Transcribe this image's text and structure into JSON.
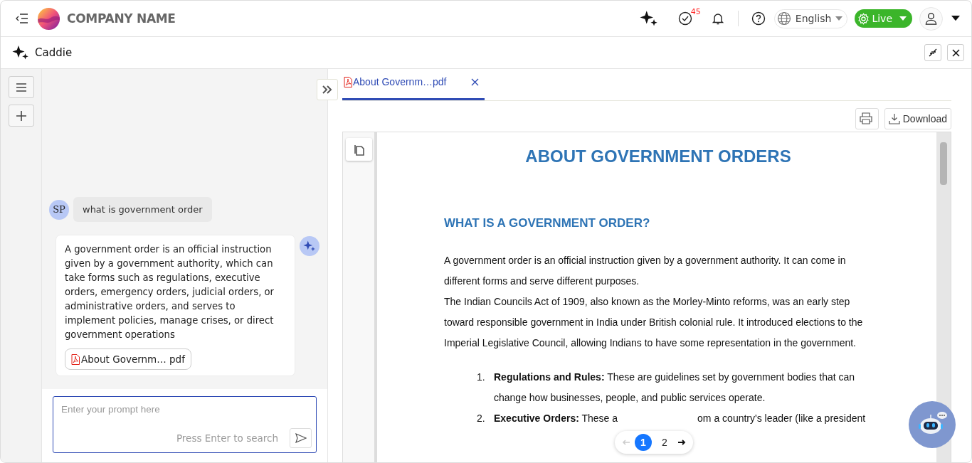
{
  "header": {
    "company_name": "COMPANY NAME",
    "notification_badge": "45",
    "language": "English",
    "status": "Live"
  },
  "panel": {
    "title": "Caddie"
  },
  "chat": {
    "messages": [
      {
        "kind": "user",
        "initials": "SP",
        "text": "what is government order"
      },
      {
        "kind": "bot",
        "text": "A government order is an official instruction given by a government authority, which can take forms such as regulations, executive orders, emergency orders, judicial orders, or administrative orders, and serves to implement policies, manage crises, or direct government operations",
        "attachment": "About Governm… pdf"
      }
    ],
    "input": {
      "placeholder": "Enter your prompt here",
      "hint": "Press Enter to search"
    }
  },
  "viewer": {
    "tabs": [
      {
        "label": "About Governm…pdf",
        "selected": true
      }
    ],
    "download": "Download",
    "document": {
      "title": "ABOUT GOVERNMENT ORDERS",
      "heading": "WHAT IS A GOVERNMENT ORDER?",
      "paragraphs": [
        "A government order is an official instruction given by a government authority. It can come in different forms and serve different purposes.",
        "The Indian Councils Act of 1909, also known as the Morley-Minto reforms, was an early step toward responsible government in India under British colonial rule. It introduced elections to the Imperial Legislative Council, allowing Indians to have some representation in the government."
      ],
      "list": [
        {
          "number": "1.",
          "lead": "Regulations and Rules:",
          "text": "These are guidelines set by government bodies that can change how businesses, people, and public services operate."
        },
        {
          "number": "2.",
          "lead": "Executive Orders:",
          "text": "These a",
          "text_after": "om a country's leader (like a president"
        }
      ]
    },
    "pagination": {
      "pages": [
        {
          "label": "1",
          "selected": true
        },
        {
          "label": "2",
          "selected": false
        }
      ]
    }
  }
}
